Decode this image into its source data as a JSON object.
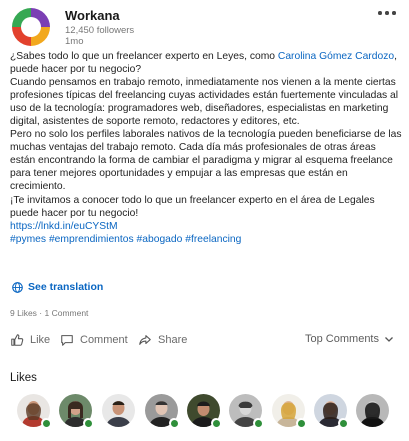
{
  "header": {
    "author": "Workana",
    "followers": "12,450 followers",
    "age": "1mo"
  },
  "post": {
    "p1_before": "¿Sabes todo lo que un freelancer experto en Leyes, como ",
    "mention": "Carolina Gómez Cardozo",
    "p1_after": ", puede hacer por tu negocio?",
    "p2": "Cuando pensamos en trabajo remoto, inmediatamente nos vienen a la mente ciertas profesiones típicas del freelancing cuyas actividades están fuertemente vinculadas al uso de la tecnología: programadores web, diseñadores, especialistas en marketing digital, asistentes de soporte remoto, redactores y editores, etc.",
    "p3": "Pero no solo los perfiles laborales nativos de la tecnología pueden beneficiarse de las muchas ventajas del trabajo remoto. Cada día más profesionales de otras áreas están encontrando la forma de cambiar el paradigma y migrar al esquema freelance para tener mejores oportunidades y empujar a las empresas que están en crecimiento.",
    "p4": "¡Te invitamos a conocer todo lo que un freelancer experto en el área de Legales puede hacer por tu negocio!",
    "link": "https://lnkd.in/euCYStM",
    "hashtags": [
      "#pymes",
      "#emprendimientos",
      "#abogado",
      "#freelancing"
    ]
  },
  "translation": {
    "label": "See translation",
    "icon": "globe-icon"
  },
  "counts": "9 Likes · 1 Comment",
  "actions": {
    "like": "Like",
    "comment": "Comment",
    "share": "Share",
    "sort": "Top Comments"
  },
  "likes": {
    "title": "Likes",
    "count_shown": 10,
    "status_color": "#2f8f3a"
  },
  "colors": {
    "link": "#0a66c2",
    "logo": [
      "#7b3fb4",
      "#f2a81d",
      "#e2412d",
      "#36a853"
    ]
  }
}
